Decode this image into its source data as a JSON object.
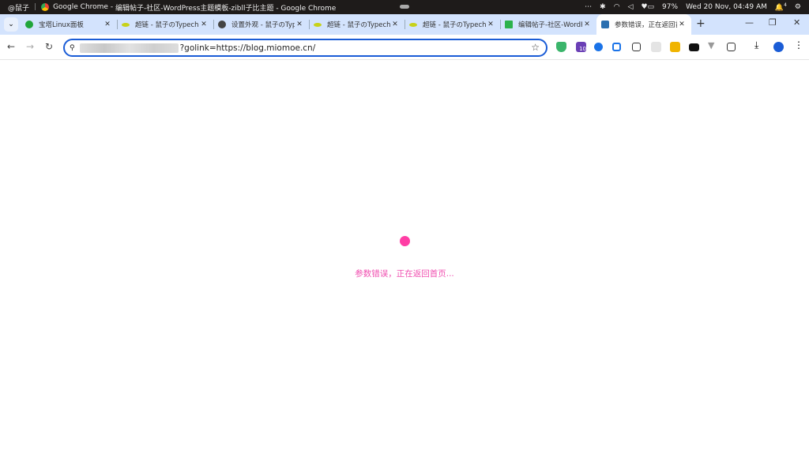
{
  "os_bar": {
    "user": "@鼠子",
    "app": "Google Chrome",
    "window_title": "编辑帖子-社区-WordPress主题模板-zibll子比主题 - Google Chrome",
    "battery": "97%",
    "datetime": "Wed 20 Nov, 04:49 AM",
    "notifications": "4"
  },
  "tabs": [
    {
      "label": "宝塔Linux面板",
      "icon": "shield-icon",
      "color": "#20a53a"
    },
    {
      "label": "超链 - 鼠子のTypecho",
      "icon": "leaf-icon",
      "color": "#c7d21a"
    },
    {
      "label": "设置外观 - 鼠子のTypecho",
      "icon": "globe-icon",
      "color": "#444444"
    },
    {
      "label": "超链 - 鼠子のTypecho",
      "icon": "leaf-icon",
      "color": "#c7d21a"
    },
    {
      "label": "超链 - 鼠子のTypecho",
      "icon": "leaf-icon",
      "color": "#c7d21a"
    },
    {
      "label": "编辑帖子-社区-WordPress",
      "icon": "z-icon",
      "color": "#2bb24c"
    },
    {
      "label": "参数错误，正在返回首页",
      "icon": "site-icon",
      "color": "#2a6fb0",
      "active": true
    }
  ],
  "address": {
    "url_visible": "?golink=https://blog.miomoe.cn/"
  },
  "extensions": {
    "badge": "10"
  },
  "page": {
    "message": "参数错误，正在返回首页...",
    "accent": "#ff3ea5"
  }
}
